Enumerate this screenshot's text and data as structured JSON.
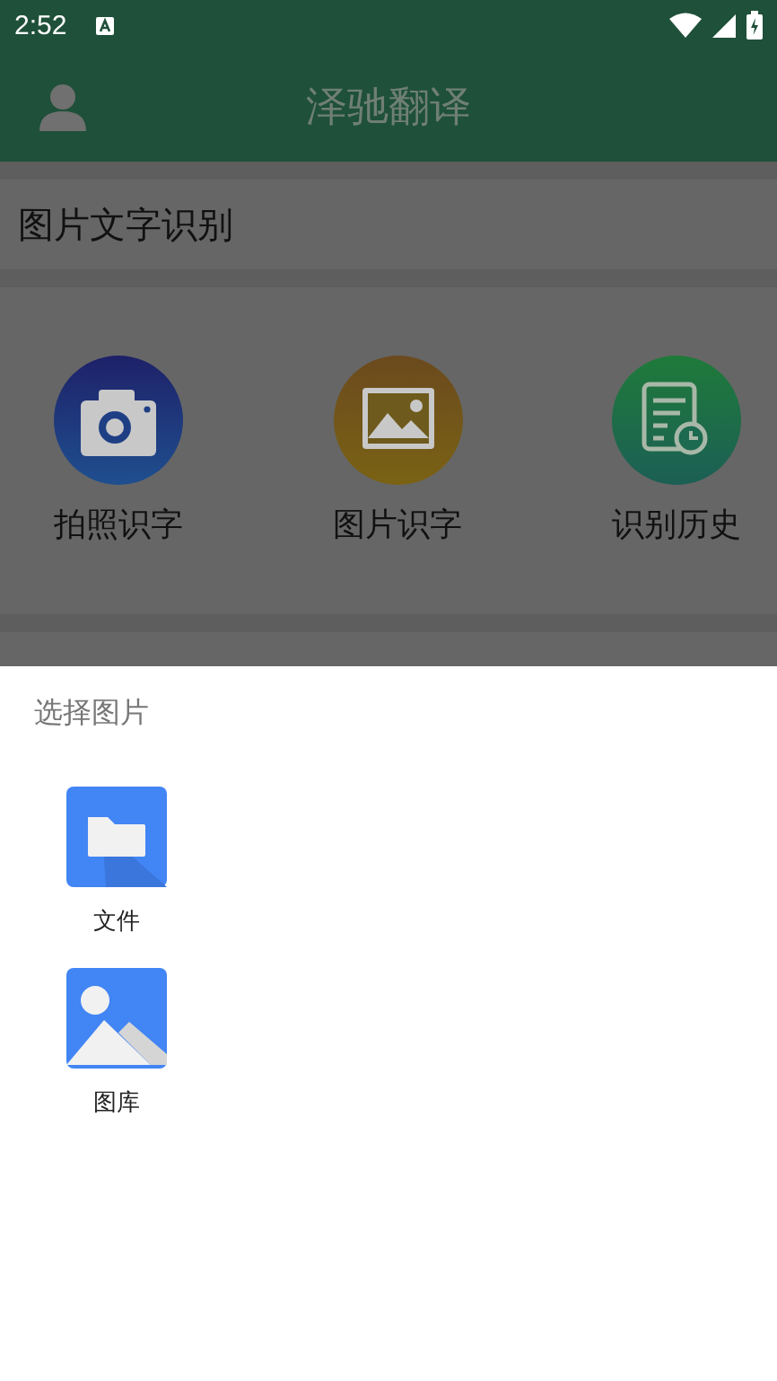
{
  "status_bar": {
    "time": "2:52"
  },
  "app_bar": {
    "title": "泽驰翻译"
  },
  "sections": [
    {
      "title": "图片文字识别",
      "actions": [
        {
          "kind": "camera",
          "label": "拍照识字"
        },
        {
          "kind": "image",
          "label": "图片识字"
        },
        {
          "kind": "history",
          "label": "识别历史"
        }
      ]
    }
  ],
  "sheet": {
    "title": "选择图片",
    "options": [
      {
        "kind": "files",
        "label": "文件"
      },
      {
        "kind": "gallery",
        "label": "图库"
      }
    ]
  }
}
